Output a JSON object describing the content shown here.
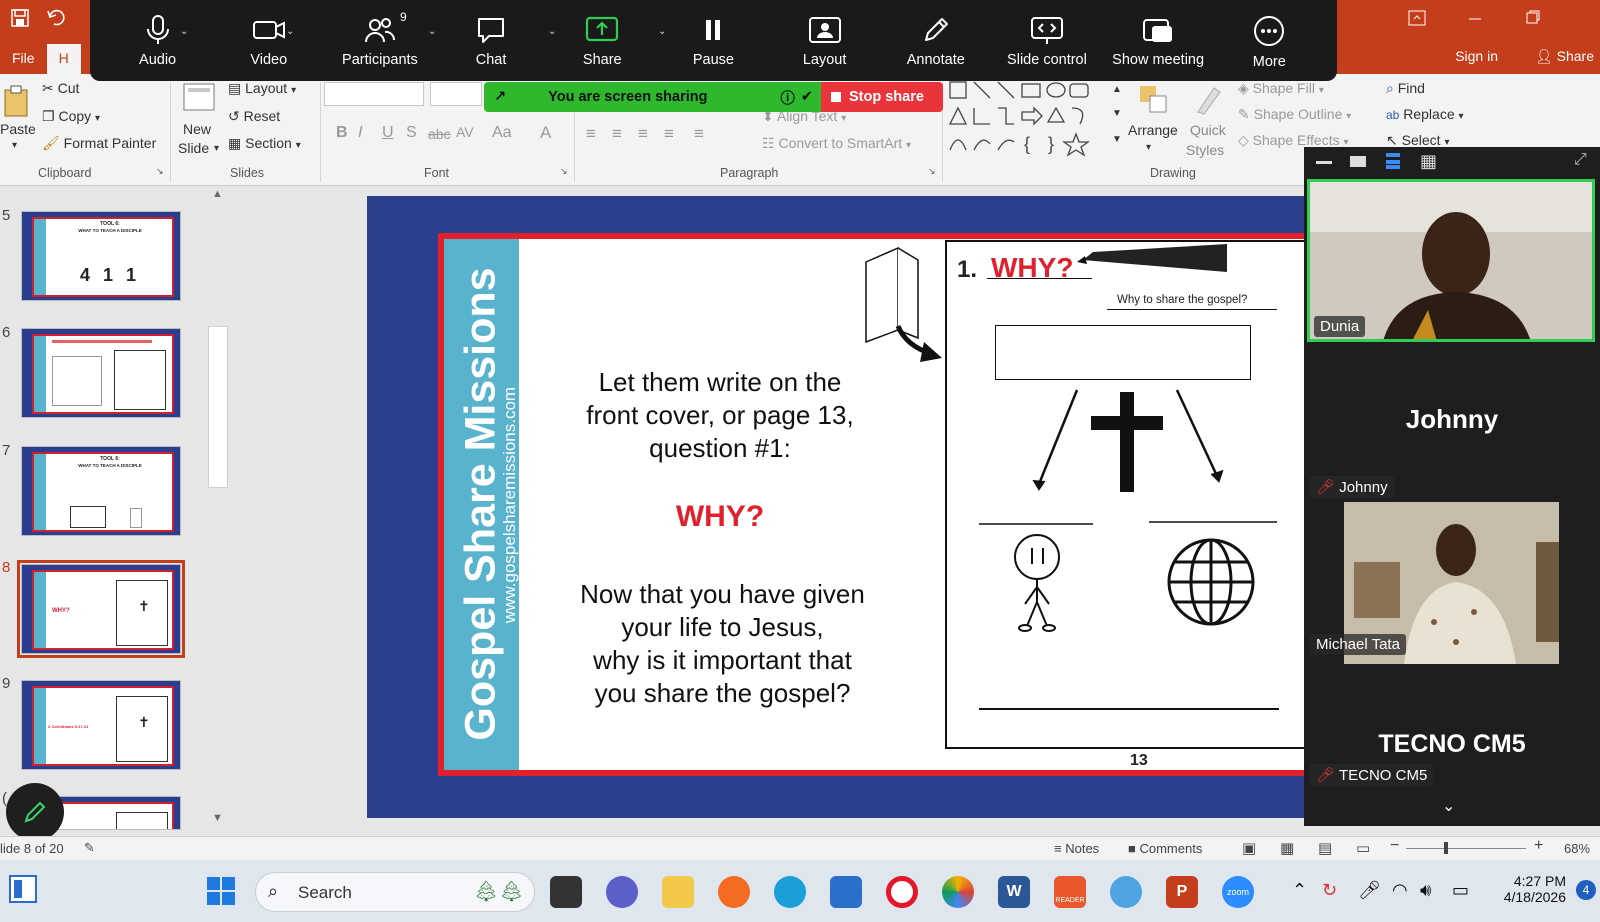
{
  "ppt": {
    "tabs": [
      "File",
      "H"
    ],
    "sign_in": "Sign in",
    "share": "Share"
  },
  "ribbon": {
    "clipboard": {
      "paste": "Paste",
      "cut": "Cut",
      "copy": "Copy",
      "format_painter": "Format Painter",
      "group": "Clipboard"
    },
    "slides": {
      "new_slide_1": "New",
      "new_slide_2": "Slide",
      "layout": "Layout",
      "reset": "Reset",
      "section": "Section",
      "group": "Slides"
    },
    "font": {
      "group": "Font",
      "bold": "B",
      "italic": "I",
      "underline": "U",
      "strike": "S",
      "abc": "abc",
      "av": "AV",
      "aa": "Aa",
      "a": "A"
    },
    "paragraph": {
      "group": "Paragraph",
      "align_text": "Align Text",
      "convert": "Convert to SmartArt"
    },
    "drawing": {
      "group": "Drawing",
      "arrange": "Arrange",
      "quick_styles_1": "Quick",
      "quick_styles_2": "Styles",
      "shape_fill": "Shape Fill",
      "shape_outline": "Shape Outline",
      "shape_effects": "Shape Effects"
    },
    "editing": {
      "find": "Find",
      "replace": "Replace",
      "select": "Select"
    }
  },
  "zoom": {
    "toolbar": [
      {
        "label": "Audio",
        "icon": "microphone-icon"
      },
      {
        "label": "Video",
        "icon": "video-camera-icon"
      },
      {
        "label": "Participants",
        "icon": "participants-icon"
      },
      {
        "label": "Chat",
        "icon": "chat-icon"
      },
      {
        "label": "Share",
        "icon": "share-screen-icon"
      },
      {
        "label": "Pause",
        "icon": "pause-icon"
      },
      {
        "label": "Layout",
        "icon": "layout-icon"
      },
      {
        "label": "Annotate",
        "icon": "pencil-icon"
      },
      {
        "label": "Slide control",
        "icon": "slide-control-icon"
      },
      {
        "label": "Show meeting",
        "icon": "show-meeting-icon"
      },
      {
        "label": "More",
        "icon": "more-icon"
      }
    ],
    "participant_count": "9",
    "sharing_banner": "You are screen sharing",
    "stop_share": "Stop share",
    "participants": [
      {
        "name": "Dunia"
      },
      {
        "name": "Johnny",
        "tile_name": "Johnny"
      },
      {
        "name": "Michael Tata"
      },
      {
        "name": "TECNO CM5",
        "tile_name": "TECNO CM5"
      }
    ]
  },
  "slides_panel": {
    "thumbs": [
      {
        "num": "5",
        "title": "TOOL 6:",
        "subtitle": "WHAT TO TEACH A DISCIPLE",
        "big": "4  1  1"
      },
      {
        "num": "6",
        "title": "",
        "subtitle": "",
        "big": ""
      },
      {
        "num": "7",
        "title": "TOOL 6:",
        "subtitle": "WHAT TO TEACH A DISCIPLE",
        "big": ""
      },
      {
        "num": "8",
        "title": "",
        "subtitle": "WHY?",
        "big": ""
      },
      {
        "num": "9",
        "title": "",
        "subtitle": "2 Corinthians 5:17-21",
        "big": ""
      },
      {
        "num": "(",
        "title": "",
        "subtitle": "",
        "big": ""
      }
    ]
  },
  "slide": {
    "vertical_title": "Gospel Share Missions",
    "vertical_url": "www.gospelsharemissions.com",
    "text1": [
      "Let them write on the",
      "front cover, or page 13,",
      "question #1:"
    ],
    "why": "WHY?",
    "text2": [
      "Now that you have given",
      "your life to Jesus,",
      "why is it important that",
      "you share the gospel?"
    ],
    "page": {
      "number_label": "1.",
      "why": "WHY?",
      "question": "Why to share the gospel?",
      "page_number": "13"
    }
  },
  "statusbar": {
    "slide_counter": "lide 8 of 20",
    "notes": "Notes",
    "comments": "Comments",
    "zoom_level": "68%"
  },
  "taskbar": {
    "search": "Search",
    "time": "4:27 PM",
    "date": "4/18/2026",
    "notification_count": "4",
    "reader_label": "READER",
    "zoom_label": "zoom"
  },
  "colors": {
    "ppt_red": "#c43e1c",
    "slide_red": "#e0202b",
    "strip": "#5ab3cc",
    "sharing_green": "#2eb82e"
  }
}
